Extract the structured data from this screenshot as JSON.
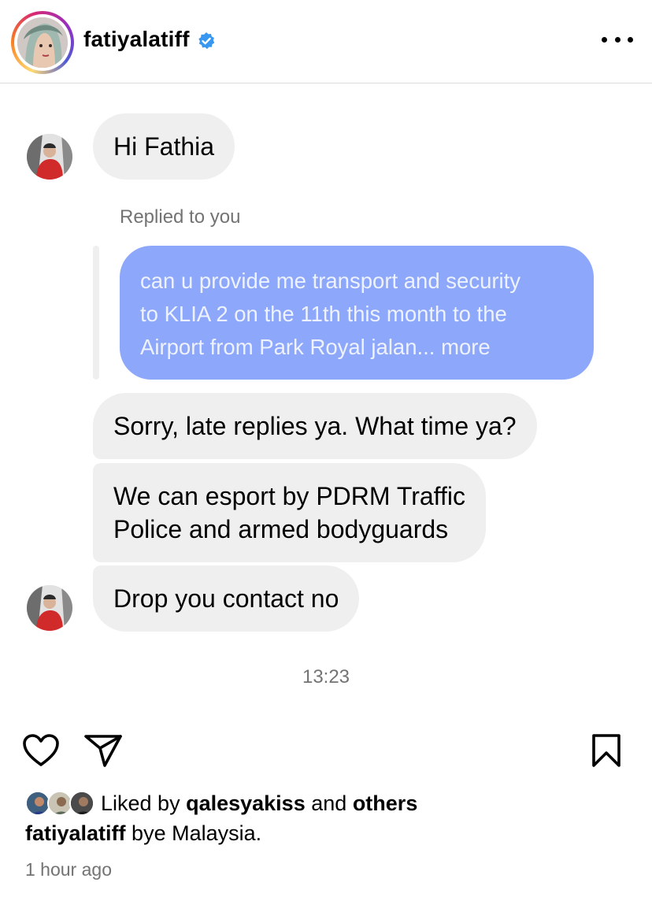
{
  "post_header": {
    "username": "fatiyalatiff",
    "verified_color": "#3897f0"
  },
  "chat": {
    "messages": [
      {
        "text": "Hi Fathia"
      },
      {
        "text": "Sorry, late replies ya. What time ya?"
      },
      {
        "lines": [
          "We can esport by PDRM Traffic",
          "Police and armed bodyguards"
        ]
      },
      {
        "text": "Drop you contact no"
      }
    ],
    "replied_label": "Replied to you",
    "reply": {
      "lines": [
        "can u provide me transport and security",
        "to KLIA 2 on the 11th this month to the",
        "Airport from Park Royal jalan... more"
      ],
      "bubble_color": "#8da7fb"
    },
    "timestamp": "13:23"
  },
  "actions": {
    "like_icon": "heart-icon",
    "share_icon": "paper-plane-icon",
    "save_icon": "bookmark-icon"
  },
  "likes": {
    "prefix": "Liked by",
    "user": "qalesyakiss",
    "conjunction": "and",
    "others": "others"
  },
  "caption": {
    "username": "fatiyalatiff",
    "text": "bye Malaysia."
  },
  "time_ago": "1 hour ago"
}
